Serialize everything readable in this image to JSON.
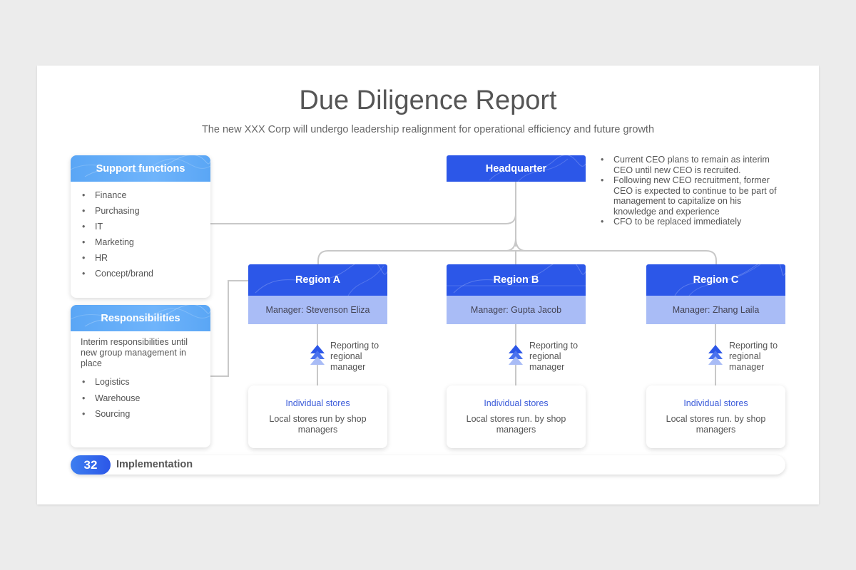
{
  "title": "Due Diligence Report",
  "subtitle": "The new XXX Corp will undergo leadership realignment for operational efficiency and future growth",
  "support": {
    "heading": "Support functions",
    "items": [
      "Finance",
      "Purchasing",
      "IT",
      "Marketing",
      "HR",
      "Concept/brand"
    ]
  },
  "responsibilities": {
    "heading": "Responsibilities",
    "intro": "Interim responsibilities until new group management in place",
    "items": [
      "Logistics",
      "Warehouse",
      "Sourcing"
    ]
  },
  "headquarter": {
    "label": "Headquarter",
    "notes": [
      "Current CEO plans to remain as interim CEO until new CEO is recruited.",
      "Following new CEO recruitment, former CEO is expected to continue to be part of management to capitalize on his knowledge and experience",
      "CFO to be replaced immediately"
    ]
  },
  "regions": [
    {
      "name": "Region A",
      "manager": "Manager: Stevenson Eliza",
      "report": "Reporting to regional manager",
      "store_title": "Individual stores",
      "store_desc": "Local stores run by shop managers"
    },
    {
      "name": "Region B",
      "manager": "Manager: Gupta Jacob",
      "report": "Reporting to regional manager",
      "store_title": "Individual stores",
      "store_desc": "Local stores run. by shop managers"
    },
    {
      "name": "Region C",
      "manager": "Manager: Zhang Laila",
      "report": "Reporting to regional manager",
      "store_title": "Individual stores",
      "store_desc": "Local stores run. by shop managers"
    }
  ],
  "footer": {
    "page": "32",
    "label": "Implementation"
  },
  "colors": {
    "primary_blue": "#2c57e8",
    "light_blue": "#5aa6f5",
    "manager_bg": "#a9bcf6",
    "connector": "#c8c8c8"
  },
  "icons": {
    "report_arrow": "chevron-up-arrows-icon"
  }
}
